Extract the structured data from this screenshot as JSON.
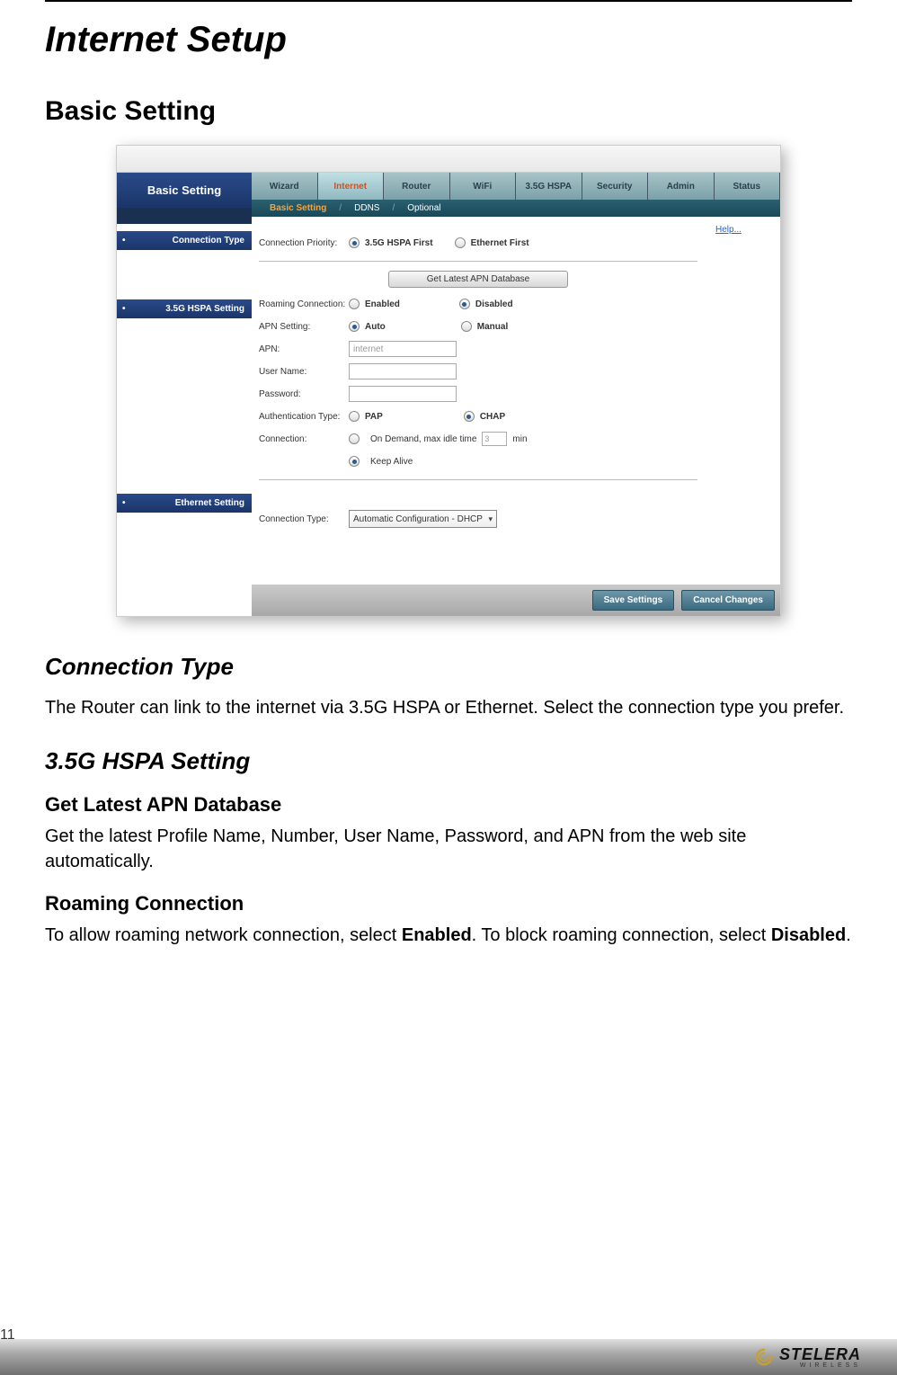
{
  "page_number": "11",
  "title": "Internet Setup",
  "section1": "Basic Setting",
  "sub_connection_type": {
    "heading": "Connection Type",
    "text": "The Router can link to the internet via 3.5G HSPA or Ethernet. Select the connection type you prefer."
  },
  "sub_hspa": {
    "heading": "3.5G HSPA Setting",
    "apn_db": {
      "heading": "Get Latest APN Database",
      "text": "Get the latest Profile Name, Number, User Name, Password, and APN from the web site automatically."
    },
    "roaming": {
      "heading": "Roaming Connection",
      "text1": "To allow roaming network connection, select ",
      "bold1": "Enabled",
      "text2": ". To block roaming connection, select ",
      "bold2": "Disabled",
      "text3": "."
    }
  },
  "router_ui": {
    "sidebar_title": "Basic Setting",
    "sidebar_labels": {
      "connection_type": "Connection Type",
      "hspa_setting": "3.5G HSPA Setting",
      "ethernet_setting": "Ethernet Setting"
    },
    "tabs": [
      "Wizard",
      "Internet",
      "Router",
      "WiFi",
      "3.5G HSPA",
      "Security",
      "Admin",
      "Status"
    ],
    "subtabs": {
      "active": "Basic Setting",
      "ddns": "DDNS",
      "optional": "Optional"
    },
    "help": "Help...",
    "form": {
      "connection_priority_label": "Connection Priority:",
      "hspa_first": "3.5G HSPA First",
      "ethernet_first": "Ethernet First",
      "get_apn_btn": "Get Latest APN Database",
      "roaming_label": "Roaming Connection:",
      "enabled": "Enabled",
      "disabled": "Disabled",
      "apn_setting_label": "APN Setting:",
      "auto": "Auto",
      "manual": "Manual",
      "apn_label": "APN:",
      "apn_value": "internet",
      "username_label": "User Name:",
      "password_label": "Password:",
      "auth_label": "Authentication Type:",
      "pap": "PAP",
      "chap": "CHAP",
      "connection_label": "Connection:",
      "on_demand": "On Demand, max idle time",
      "idle_value": "3",
      "min": "min",
      "keep_alive": "Keep Alive",
      "ethernet_conn_type_label": "Connection Type:",
      "ethernet_conn_value": "Automatic Configuration - DHCP"
    },
    "buttons": {
      "save": "Save Settings",
      "cancel": "Cancel Changes"
    }
  },
  "footer": {
    "logo_main": "STELERA",
    "logo_sub": "WIRELESS"
  }
}
